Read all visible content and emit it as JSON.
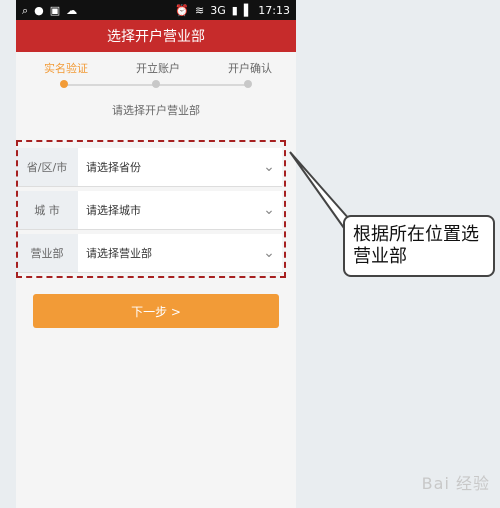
{
  "statusbar": {
    "left_icons": [
      "search-icon",
      "app-icon",
      "image-icon",
      "weather-icon"
    ],
    "right_icons": [
      "alarm-icon",
      "wifi-icon",
      "3g-icon",
      "signal-icon",
      "battery-icon"
    ],
    "network": "3G",
    "time": "17:13"
  },
  "header": {
    "title": "选择开户营业部"
  },
  "steps": [
    {
      "label": "实名验证"
    },
    {
      "label": "开立账户"
    },
    {
      "label": "开户确认"
    }
  ],
  "section": {
    "title": "请选择开户营业部"
  },
  "form": {
    "rows": [
      {
        "label": "省/区/市",
        "value": "请选择省份"
      },
      {
        "label": "城 市",
        "value": "请选择城市"
      },
      {
        "label": "营业部",
        "value": "请选择营业部"
      }
    ]
  },
  "next_button": {
    "label": "下一步 >"
  },
  "annotation": {
    "text": "根据所在位置选营业部"
  },
  "watermark": {
    "text": "Bai 经验"
  },
  "colors": {
    "header_bg": "#c62b2b",
    "accent": "#f29b37",
    "dashed_border": "#a62020"
  }
}
